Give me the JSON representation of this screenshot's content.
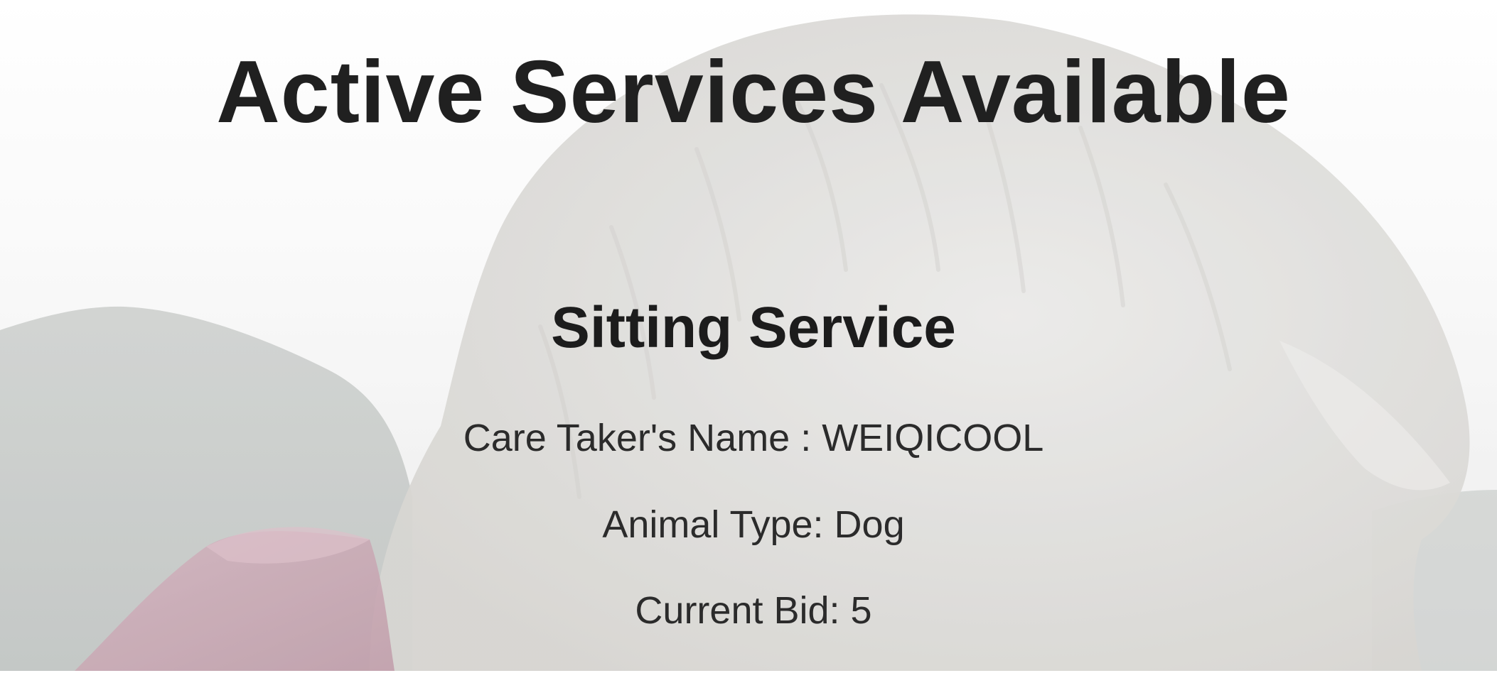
{
  "page": {
    "title": "Active Services Available"
  },
  "service": {
    "title": "Sitting Service",
    "caretaker_line": "Care Taker's Name : WEIQICOOL",
    "animal_line": "Animal Type: Dog",
    "bid_line": "Current Bid: 5"
  },
  "colors": {
    "title_text": "#202020",
    "body_text": "#2b2b2b",
    "backdrop_sky": "#fbfbfb",
    "backdrop_fur": "#d9d8d6",
    "backdrop_hills": "#aeb3b0",
    "backdrop_collar": "#b78b9a"
  }
}
